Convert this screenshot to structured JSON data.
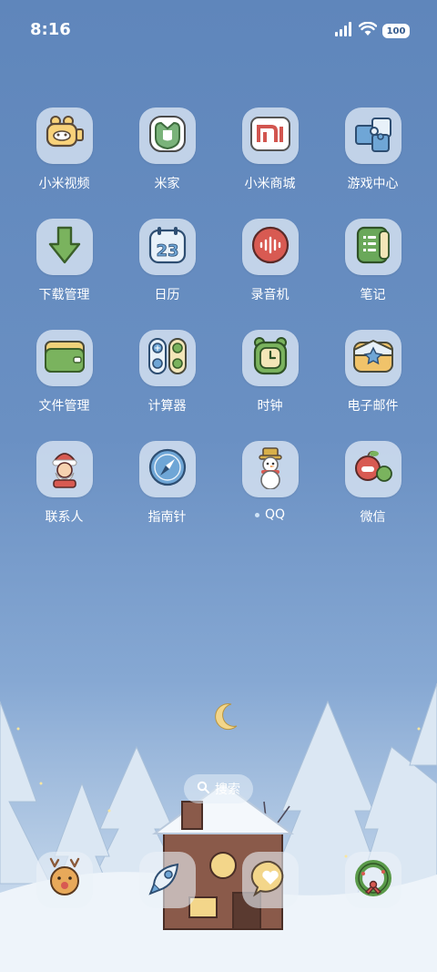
{
  "status": {
    "time": "8:16",
    "battery": "100"
  },
  "apps": [
    {
      "label": "小米视频",
      "icon": "video-camera-icon"
    },
    {
      "label": "米家",
      "icon": "mi-home-icon"
    },
    {
      "label": "小米商城",
      "icon": "mi-store-icon"
    },
    {
      "label": "游戏中心",
      "icon": "puzzle-icon"
    },
    {
      "label": "下载管理",
      "icon": "download-arrow-icon"
    },
    {
      "label": "日历",
      "icon": "calendar-icon",
      "day": "23"
    },
    {
      "label": "录音机",
      "icon": "recorder-icon"
    },
    {
      "label": "笔记",
      "icon": "notes-icon"
    },
    {
      "label": "文件管理",
      "icon": "folder-icon"
    },
    {
      "label": "计算器",
      "icon": "calculator-icon"
    },
    {
      "label": "时钟",
      "icon": "clock-icon"
    },
    {
      "label": "电子邮件",
      "icon": "mail-icon"
    },
    {
      "label": "联系人",
      "icon": "santa-icon"
    },
    {
      "label": "指南针",
      "icon": "compass-icon"
    },
    {
      "label": "QQ",
      "icon": "snowman-icon"
    },
    {
      "label": "微信",
      "icon": "apple-chat-icon"
    }
  ],
  "search": {
    "label": "搜索"
  },
  "dock": [
    {
      "icon": "reindeer-phone-icon"
    },
    {
      "icon": "rocket-icon"
    },
    {
      "icon": "heart-message-icon"
    },
    {
      "icon": "wreath-icon"
    }
  ]
}
